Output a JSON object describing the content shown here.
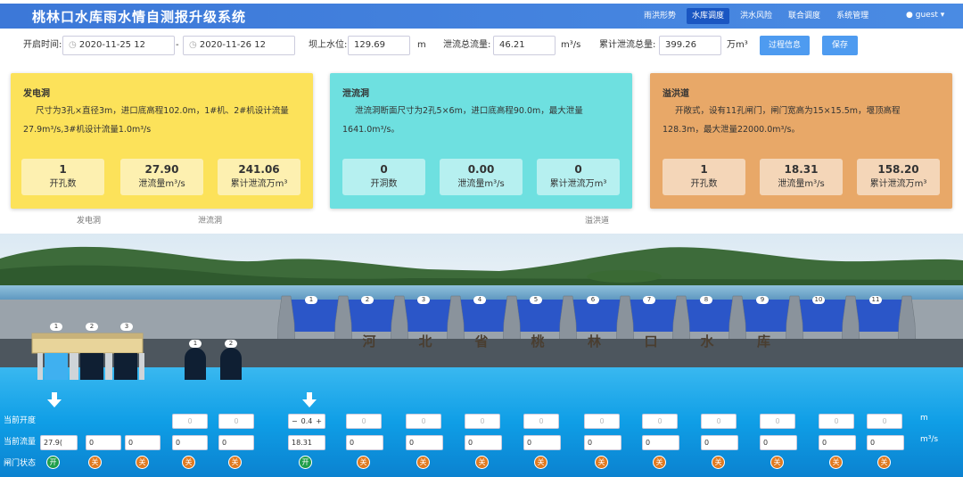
{
  "header": {
    "title": "桃林口水库雨水情自测报升级系统",
    "nav": [
      "雨洪形势",
      "水库调度",
      "洪水风险",
      "联合调度",
      "系统管理"
    ],
    "active_nav": "水库调度",
    "user": "guest ▾"
  },
  "toolbar": {
    "start_label": "开启时间:",
    "start_value": "2020-11-25 12",
    "sep": "-",
    "end_value": "2020-11-26 12",
    "level_label": "坝上水位:",
    "level_value": "129.69",
    "level_unit": "m",
    "flow_label": "泄流总流量:",
    "flow_value": "46.21",
    "flow_unit": "m³/s",
    "cum_label": "累计泄流总量:",
    "cum_value": "399.26",
    "cum_unit": "万m³",
    "process_btn": "过程信息",
    "save_btn": "保存"
  },
  "cards": {
    "power": {
      "title": "发电洞",
      "desc": "尺寸为3孔×直径3m，进口底高程102.0m，1#机、2#机设计流量27.9m³/s,3#机设计流量1.0m³/s",
      "stats": [
        {
          "value": "1",
          "label": "开孔数"
        },
        {
          "value": "27.90",
          "label": "泄流量m³/s"
        },
        {
          "value": "241.06",
          "label": "累计泄流万m³"
        }
      ],
      "color": "#fce25a",
      "stat_bg": "#fdf0b0"
    },
    "tunnel": {
      "title": "泄流洞",
      "desc": "泄流洞断面尺寸为2孔5×6m，进口底高程90.0m，最大泄量1641.0m³/s。",
      "stats": [
        {
          "value": "0",
          "label": "开洞数"
        },
        {
          "value": "0.00",
          "label": "泄流量m³/s"
        },
        {
          "value": "0",
          "label": "累计泄流万m³"
        }
      ],
      "color": "#6ee0e0",
      "stat_bg": "#b6f0f0"
    },
    "spill": {
      "title": "溢洪道",
      "desc": "开敞式，设有11孔闸门，闸门宽高为15×15.5m，堰顶高程128.3m，最大泄量22000.0m³/s。",
      "stats": [
        {
          "value": "1",
          "label": "开孔数"
        },
        {
          "value": "18.31",
          "label": "泄流量m³/s"
        },
        {
          "value": "158.20",
          "label": "累计泄流万m³"
        }
      ],
      "color": "#e8a868",
      "stat_bg": "#f4d6b8"
    }
  },
  "captions": {
    "power": "发电洞",
    "tunnel": "泄流洞",
    "spill": "溢洪道"
  },
  "dam": {
    "name": [
      "河",
      "北",
      "省",
      "桃",
      "林",
      "口",
      "水",
      "库"
    ],
    "gate_numbers": [
      "1",
      "2",
      "3",
      "4",
      "5",
      "6",
      "7",
      "8",
      "9",
      "10",
      "11"
    ],
    "power_numbers": [
      "1",
      "2",
      "3"
    ],
    "tunnel_numbers": [
      "1",
      "2"
    ]
  },
  "controls": {
    "row_labels": [
      "当前开度",
      "当前流量",
      "闸门状态"
    ],
    "units": [
      "m",
      "m³/s"
    ],
    "power_flow": [
      "27.9(",
      "0",
      "0"
    ],
    "power_state": [
      "开",
      "关",
      "关"
    ],
    "tunnel_open": [
      "0",
      "0"
    ],
    "tunnel_flow": [
      "0",
      "0"
    ],
    "tunnel_state": [
      "关",
      "关"
    ],
    "spill_open": [
      "0.4",
      "0",
      "0",
      "0",
      "0",
      "0",
      "0",
      "0",
      "0",
      "0",
      "0"
    ],
    "spill_flow": [
      "18.31",
      "0",
      "0",
      "0",
      "0",
      "0",
      "0",
      "0",
      "0",
      "0",
      "0"
    ],
    "spill_state": [
      "开",
      "关",
      "关",
      "关",
      "关",
      "关",
      "关",
      "关",
      "关",
      "关",
      "关"
    ],
    "stepper": {
      "minus": "−",
      "plus": "+"
    }
  },
  "colors": {
    "header": "#3c78d8",
    "water": "#12a2e8",
    "open": "#1f9e4a",
    "closed": "#e07a20"
  }
}
